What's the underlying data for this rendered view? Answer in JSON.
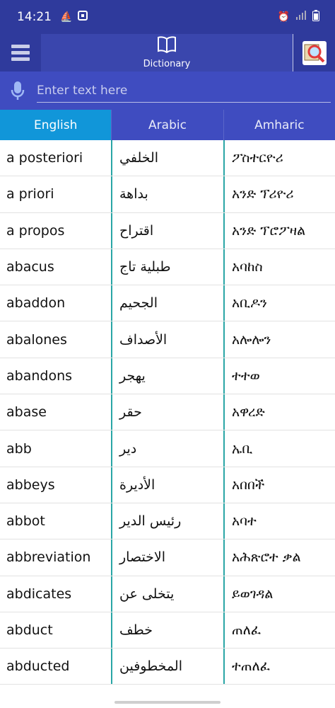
{
  "status_bar": {
    "time": "14:21",
    "left_icons": [
      "boat-icon",
      "cast-icon"
    ],
    "right_icons": [
      "alarm-icon",
      "signal-icon",
      "battery-icon"
    ]
  },
  "app_bar": {
    "title": "Dictionary",
    "menu_icon": "hamburger-menu-icon",
    "tab_icon": "book-icon",
    "search_icon": "magnifier-book-icon"
  },
  "search": {
    "placeholder": "Enter text here",
    "value": ""
  },
  "tabs": [
    {
      "label": "English",
      "active": true
    },
    {
      "label": "Arabic",
      "active": false
    },
    {
      "label": "Amharic",
      "active": false
    }
  ],
  "words": [
    {
      "en": "a posteriori",
      "ar": "الخلفي",
      "am": "ፖስተርዮሪ"
    },
    {
      "en": "a priori",
      "ar": "بداهة",
      "am": "አንድ ፕሪዮሪ"
    },
    {
      "en": "a propos",
      "ar": "اقتراح",
      "am": "አንድ ፕሮፖዛል"
    },
    {
      "en": "abacus",
      "ar": "طبلية تاج",
      "am": "አባከስ"
    },
    {
      "en": "abaddon",
      "ar": "الجحيم",
      "am": "አቢዶን"
    },
    {
      "en": "abalones",
      "ar": "الأصداف",
      "am": "አሎሎን"
    },
    {
      "en": "abandons",
      "ar": "يهجر",
      "am": "ተተወ"
    },
    {
      "en": "abase",
      "ar": "حقر",
      "am": "አዋረድ"
    },
    {
      "en": "abb",
      "ar": "دير",
      "am": "ኤቢ"
    },
    {
      "en": "abbeys",
      "ar": "الأديرة",
      "am": "አበበች"
    },
    {
      "en": "abbot",
      "ar": "رئيس الدير",
      "am": "አባተ"
    },
    {
      "en": "abbreviation",
      "ar": "الاختصار",
      "am": "አሕጽሮተ ቃል"
    },
    {
      "en": "abdicates",
      "ar": "يتخلى عن",
      "am": "ይወገዳል"
    },
    {
      "en": "abduct",
      "ar": "خطف",
      "am": "ጠለፈ"
    },
    {
      "en": "abducted",
      "ar": "المخطوفين",
      "am": "ተጠለፈ"
    }
  ]
}
